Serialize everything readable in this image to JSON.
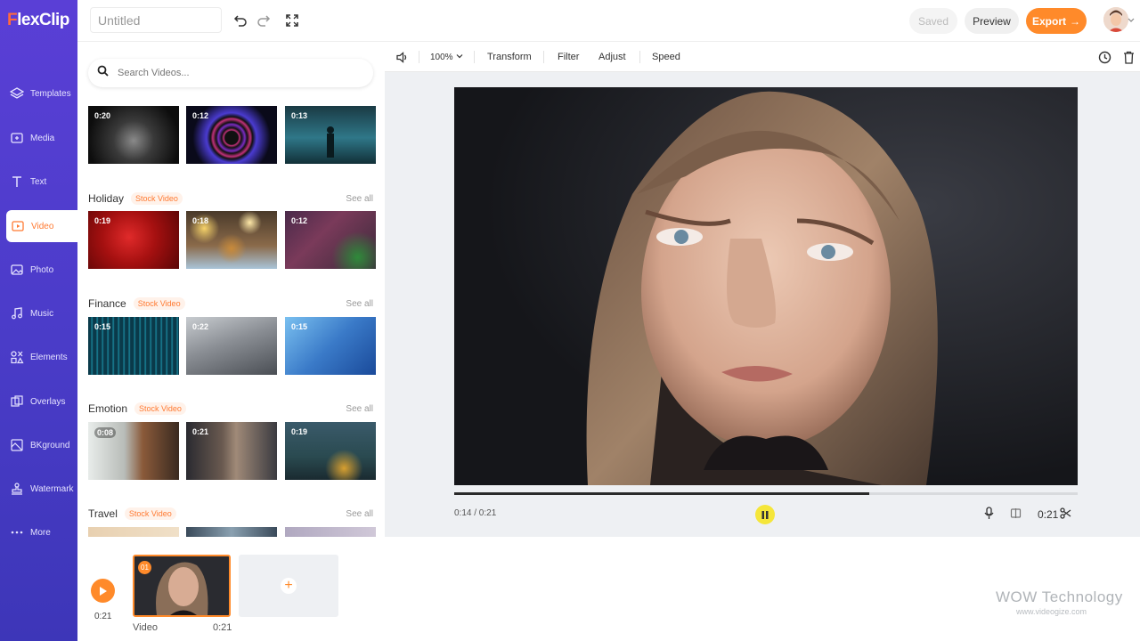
{
  "app": {
    "logo_f": "F",
    "logo_rest": "lexClip",
    "title": "Untitled"
  },
  "rail": [
    {
      "label": "Templates",
      "icon": "layers-icon"
    },
    {
      "label": "Media",
      "icon": "media-icon"
    },
    {
      "label": "Text",
      "icon": "text-icon"
    },
    {
      "label": "Video",
      "icon": "video-icon",
      "active": true
    },
    {
      "label": "Photo",
      "icon": "photo-icon"
    },
    {
      "label": "Music",
      "icon": "music-icon"
    },
    {
      "label": "Elements",
      "icon": "elements-icon"
    },
    {
      "label": "Overlays",
      "icon": "overlays-icon"
    },
    {
      "label": "BKground",
      "icon": "background-icon"
    },
    {
      "label": "Watermark",
      "icon": "watermark-icon"
    },
    {
      "label": "More",
      "icon": "more-icon"
    }
  ],
  "topbar": {
    "saved": "Saved",
    "preview": "Preview",
    "export": "Export"
  },
  "search": {
    "placeholder": "Search Videos..."
  },
  "top_durations": [
    "0:20",
    "0:12",
    "0:13"
  ],
  "categories": [
    {
      "name": "Holiday",
      "tag": "Stock Video",
      "see_all": "See all",
      "durations": [
        "0:19",
        "0:18",
        "0:12"
      ]
    },
    {
      "name": "Finance",
      "tag": "Stock Video",
      "see_all": "See all",
      "durations": [
        "0:15",
        "0:22",
        "0:15"
      ]
    },
    {
      "name": "Emotion",
      "tag": "Stock Video",
      "see_all": "See all",
      "durations": [
        "0:08",
        "0:21",
        "0:19"
      ]
    },
    {
      "name": "Travel",
      "tag": "Stock Video",
      "see_all": "See all",
      "durations": [
        "",
        "",
        ""
      ]
    }
  ],
  "toolbar": {
    "zoom": "100%",
    "transform": "Transform",
    "filter": "Filter",
    "adjust": "Adjust",
    "speed": "Speed"
  },
  "player": {
    "current": "0:14 / 0:21",
    "duration": "0:21",
    "progress": 0.666
  },
  "timeline": {
    "total": "0:21",
    "clip_number": "01",
    "clip_label": "Video",
    "clip_duration": "0:21"
  },
  "watermark": {
    "title": "WOW Technology",
    "url": "www.videogize.com"
  },
  "colors": {
    "accent": "#ff8a2a",
    "rail": "#4b3cc9"
  }
}
